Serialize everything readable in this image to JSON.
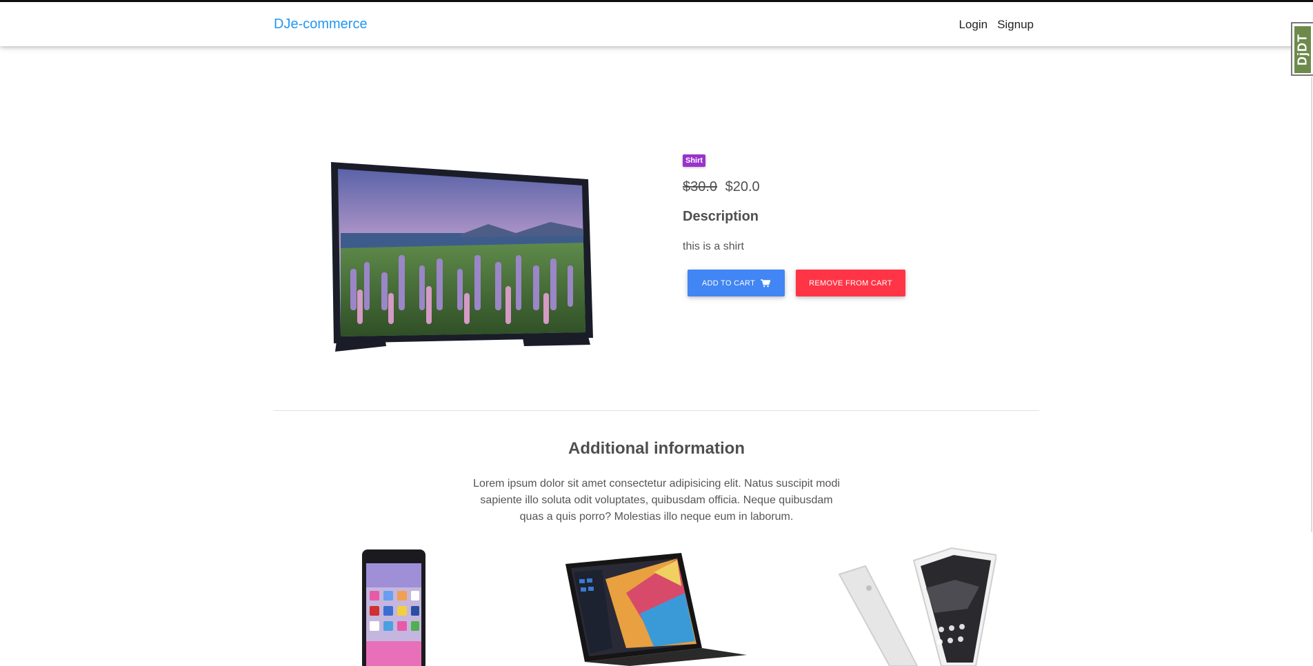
{
  "navbar": {
    "brand": "DJe-commerce",
    "login": "Login",
    "signup": "Signup"
  },
  "debug_toolbar": {
    "label": "DjDT"
  },
  "product": {
    "category_badge": "Shirt",
    "old_price": "$30.0",
    "price": "$20.0",
    "description_heading": "Description",
    "description_text": "this is a shirt",
    "add_to_cart_label": "ADD TO CART",
    "remove_from_cart_label": "REMOVE FROM CART"
  },
  "additional": {
    "title": "Additional information",
    "text": "Lorem ipsum dolor sit amet consectetur adipisicing elit. Natus suscipit modi sapiente illo soluta odit voluptates, quibusdam officia. Neque quibusdam quas a quis porro? Molestias illo neque eum in laborum."
  },
  "colors": {
    "brand": "#2196f3",
    "add_button": "#4285f4",
    "remove_button": "#ff3547",
    "badge": "#9933cc"
  },
  "icons": {
    "cart": "shopping-cart-icon",
    "product_image": "television-image",
    "thumb1": "smartphone-image",
    "thumb2": "laptop-image",
    "thumb3": "two-phones-image"
  }
}
